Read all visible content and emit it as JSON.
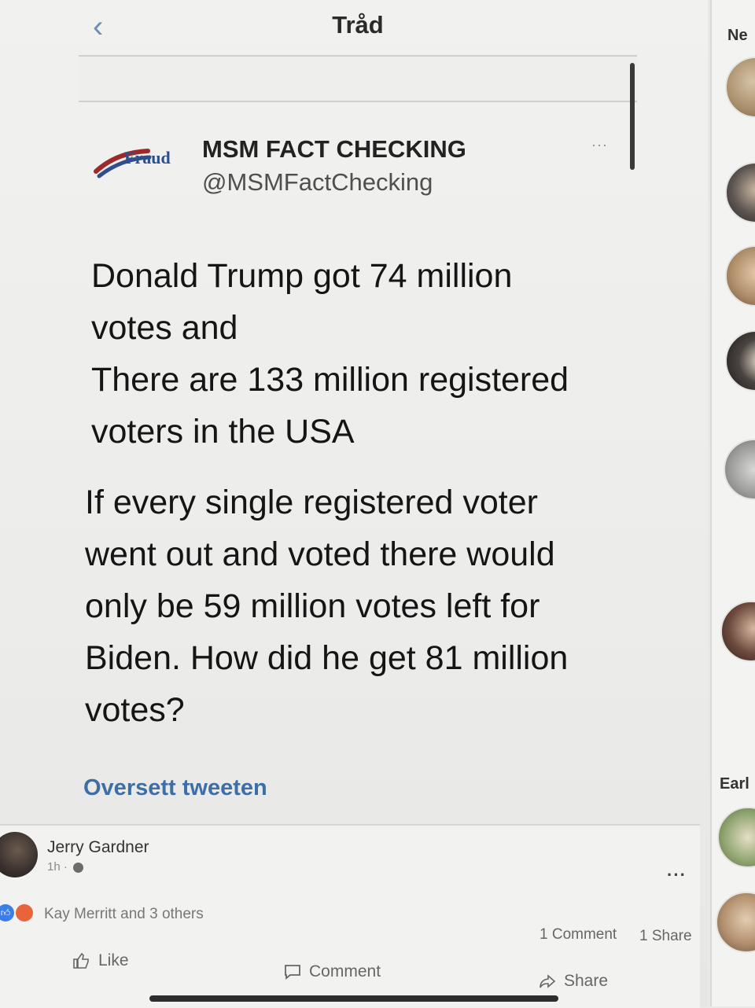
{
  "header": {
    "title": "Tråd",
    "back_icon": "chevron-left-icon"
  },
  "tweet": {
    "avatar_logo_text": "Fraud",
    "author_name": "MSM FACT CHECKING",
    "author_handle": "@MSMFactChecking",
    "more_label": "···",
    "paragraph_1_lines": [
      "Donald Trump got 74 million",
      "votes and",
      "There are 133 million registered",
      "voters in the USA"
    ],
    "paragraph_2_lines": [
      "If every single registered voter",
      "went out and voted there would",
      "only be 59 million votes left for",
      "Biden. How did he get 81 million",
      "votes?"
    ],
    "translate_label": "Oversett tweeten"
  },
  "post": {
    "poster_name": "Jerry Gardner",
    "time": "1h ·",
    "more_label": "···",
    "reactions_text": "Kay Merritt and 3 others",
    "comments_count": "1 Comment",
    "shares_count": "1 Share",
    "like_label": "Like",
    "comment_label": "Comment",
    "share_label": "Share"
  },
  "side_panel": {
    "heading_1": "Ne",
    "heading_2": "Earl"
  },
  "colors": {
    "link_blue": "#3d6ea6",
    "back_icon": "#6d8fb3",
    "like_reaction": "#3b7ee8",
    "angry_reaction": "#e8643a"
  }
}
